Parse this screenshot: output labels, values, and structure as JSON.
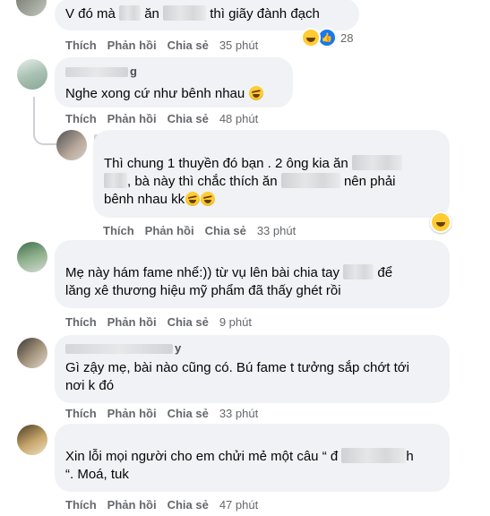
{
  "comments": [
    {
      "text_a": "V đó mà",
      "text_b": "ăn",
      "text_c": "thì giãy đành đạch",
      "actions": {
        "like": "Thích",
        "reply": "Phản hồi",
        "share": "Chia sẻ",
        "time": "35 phút"
      },
      "reaction_count": "28"
    },
    {
      "name_suffix": "g",
      "text": "Nghe xong cứ như bênh nhau",
      "actions": {
        "like": "Thích",
        "reply": "Phản hồi",
        "share": "Chia sẻ",
        "time": "48 phút"
      }
    },
    {
      "line1": "Thì chung 1 thuyền đó bạn . 2 ông kia ăn",
      "line2_a": ", bà này thì chắc thích ăn",
      "line2_b": "nên phải",
      "line3": "bênh nhau kk",
      "actions": {
        "like": "Thích",
        "reply": "Phản hồi",
        "share": "Chia sẻ",
        "time": "33 phút"
      }
    },
    {
      "line1_a": "Mẹ này hám fame nhể:)) từ vụ lên bài chia tay",
      "line1_b": "để",
      "line2": "lăng xê thương hiệu mỹ phẩm đã thấy ghét rồi",
      "actions": {
        "like": "Thích",
        "reply": "Phản hồi",
        "share": "Chia sẻ",
        "time": "9 phút"
      }
    },
    {
      "name_suffix": "y",
      "line1": "Gì zậy mẹ, bài nào cũng có. Bú fame t tưởng sắp chớt tới",
      "line2": "nơi k đó",
      "actions": {
        "like": "Thích",
        "reply": "Phản hồi",
        "share": "Chia sẻ",
        "time": "33 phút"
      }
    },
    {
      "line1_a": "Xin lỗi mọi người cho em chửi mẻ một câu “ đ",
      "line1_b": "h",
      "line2": "“. Moá, tuk",
      "actions": {
        "like": "Thích",
        "reply": "Phản hồi",
        "share": "Chia sẻ",
        "time": "47 phút"
      }
    }
  ],
  "colors": {
    "bubble": "#f0f2f5",
    "meta": "#65676b",
    "like_blue": "#1877f2",
    "haha_yellow": "#ffcc33"
  },
  "icons": [
    "haha-emoji-icon",
    "like-reaction-icon"
  ]
}
